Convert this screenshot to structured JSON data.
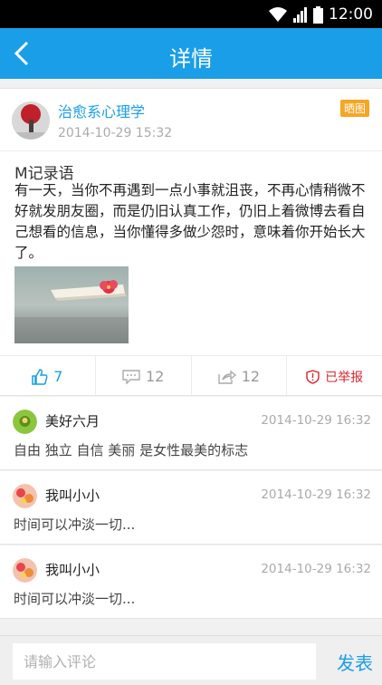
{
  "status_bar": {
    "time": "12:00"
  },
  "app_bar": {
    "title": "详情",
    "back_icon": "chevron-left-icon"
  },
  "post": {
    "author": "治愈系心理学",
    "time": "2014-10-29 15:32",
    "badge": "晒图",
    "title": "M记录语",
    "body": "有一天，当你不再遇到一点小事就沮丧，不再心情稍微不好就发朋友圈，而是仍旧认真工作，仍旧上着微博去看自己想看的信息，当你懂得多做少怨时，意味着你开始长大了。",
    "actions": {
      "like_count": "7",
      "comment_count": "12",
      "share_count": "12",
      "report_label": "已举报"
    }
  },
  "comments": [
    {
      "name": "美好六月",
      "time": "2014-10-29 16:32",
      "text": "自由 独立 自信 美丽 是女性最美的标志"
    },
    {
      "name": "我叫小小",
      "time": "2014-10-29 16:32",
      "text": "时间可以冲淡一切..."
    },
    {
      "name": "我叫小小",
      "time": "2014-10-29 16:32",
      "text": "时间可以冲淡一切..."
    }
  ],
  "input_bar": {
    "placeholder": "请输入评论",
    "send_label": "发表"
  },
  "colors": {
    "accent": "#1a9ee8",
    "badge": "#f5a623",
    "report": "#d9262e"
  }
}
